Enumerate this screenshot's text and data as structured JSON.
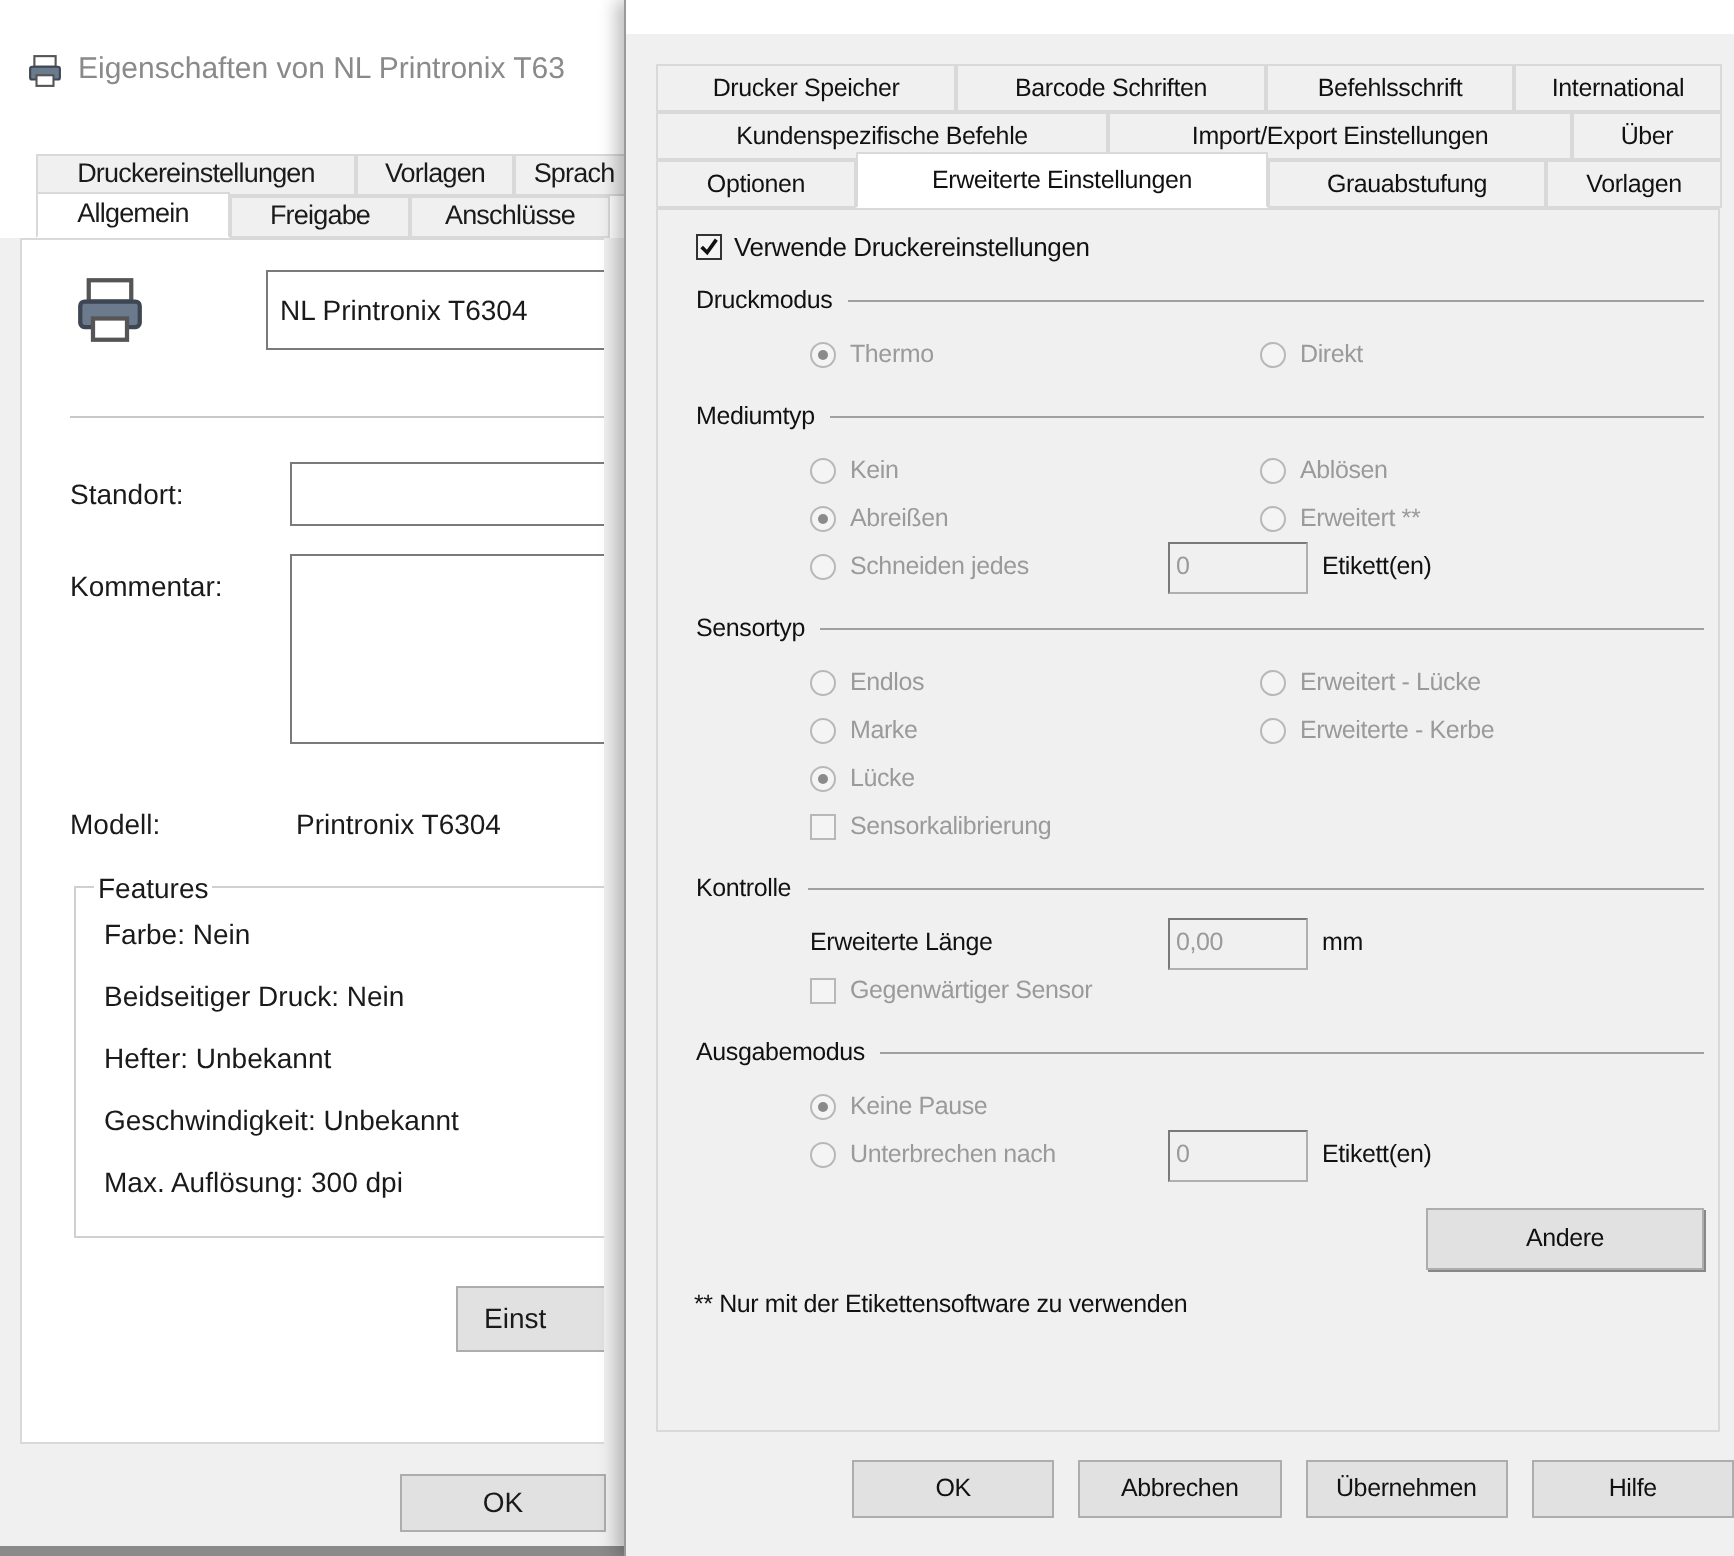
{
  "back_window": {
    "title": "Eigenschaften von NL Printronix T63",
    "tab_rows": [
      [
        {
          "label": "Druckereinstellungen",
          "selected": false
        },
        {
          "label": "Vorlagen",
          "selected": false
        },
        {
          "label": "Sprach",
          "selected": false
        }
      ],
      [
        {
          "label": "Allgemein",
          "selected": true
        },
        {
          "label": "Freigabe",
          "selected": false
        },
        {
          "label": "Anschlüsse",
          "selected": false
        }
      ]
    ],
    "printer_name": "NL Printronix T6304",
    "location_label": "Standort:",
    "comment_label": "Kommentar:",
    "model_label": "Modell:",
    "model_value": "Printronix T6304",
    "features": {
      "title": "Features",
      "items": [
        "Farbe: Nein",
        "Beidseitiger Druck: Nein",
        "Hefter: Unbekannt",
        "Geschwindigkeit: Unbekannt",
        "Max. Auflösung: 300 dpi"
      ]
    },
    "settings_button": "Einst",
    "ok_button": "OK"
  },
  "front_window": {
    "tab_rows": [
      [
        {
          "label": "Drucker Speicher",
          "selected": false
        },
        {
          "label": "Barcode Schriften",
          "selected": false
        },
        {
          "label": "Befehlsschrift",
          "selected": false
        },
        {
          "label": "International",
          "selected": false
        }
      ],
      [
        {
          "label": "Kundenspezifische Befehle",
          "selected": false
        },
        {
          "label": "Import/Export Einstellungen",
          "selected": false
        },
        {
          "label": "Über",
          "selected": false
        }
      ],
      [
        {
          "label": "Optionen",
          "selected": false
        },
        {
          "label": "Erweiterte Einstellungen",
          "selected": true
        },
        {
          "label": "Grauabstufung",
          "selected": false
        },
        {
          "label": "Vorlagen",
          "selected": false
        }
      ]
    ],
    "use_settings": {
      "label": "Verwende Druckereinstellungen",
      "checked": true
    },
    "sections": [
      {
        "title": "Druckmodus",
        "rows": [
          [
            {
              "kind": "radio",
              "label": "Thermo",
              "selected": true,
              "disabled": true
            },
            {
              "kind": "radio",
              "label": "Direkt",
              "selected": false,
              "disabled": true
            }
          ]
        ]
      },
      {
        "title": "Mediumtyp",
        "rows": [
          [
            {
              "kind": "radio",
              "label": "Kein",
              "selected": false,
              "disabled": true
            },
            {
              "kind": "radio",
              "label": "Ablösen",
              "selected": false,
              "disabled": true
            }
          ],
          [
            {
              "kind": "radio",
              "label": "Abreißen",
              "selected": true,
              "disabled": true
            },
            {
              "kind": "radio",
              "label": "Erweitert **",
              "selected": false,
              "disabled": true
            }
          ],
          [
            {
              "kind": "radio",
              "label": "Schneiden jedes",
              "selected": false,
              "disabled": true
            },
            {
              "kind": "field",
              "value": "0",
              "unit": "Etikett(en)"
            }
          ]
        ]
      },
      {
        "title": "Sensortyp",
        "rows": [
          [
            {
              "kind": "radio",
              "label": "Endlos",
              "selected": false,
              "disabled": true
            },
            {
              "kind": "radio",
              "label": "Erweitert - Lücke",
              "selected": false,
              "disabled": true
            }
          ],
          [
            {
              "kind": "radio",
              "label": "Marke",
              "selected": false,
              "disabled": true
            },
            {
              "kind": "radio",
              "label": "Erweiterte - Kerbe",
              "selected": false,
              "disabled": true
            }
          ],
          [
            {
              "kind": "radio",
              "label": "Lücke",
              "selected": true,
              "disabled": true
            }
          ],
          [
            {
              "kind": "checkbox",
              "label": "Sensorkalibrierung",
              "checked": false,
              "disabled": true
            }
          ]
        ]
      },
      {
        "title": "Kontrolle",
        "rows": [
          [
            {
              "kind": "label",
              "label": "Erweiterte Länge"
            },
            {
              "kind": "field",
              "value": "0,00",
              "unit": "mm"
            }
          ],
          [
            {
              "kind": "checkbox",
              "label": "Gegenwärtiger Sensor",
              "checked": false,
              "disabled": true
            }
          ]
        ]
      },
      {
        "title": "Ausgabemodus",
        "rows": [
          [
            {
              "kind": "radio",
              "label": "Keine Pause",
              "selected": true,
              "disabled": true
            }
          ],
          [
            {
              "kind": "radio",
              "label": "Unterbrechen nach",
              "selected": false,
              "disabled": true
            },
            {
              "kind": "field",
              "value": "0",
              "unit": "Etikett(en)"
            }
          ]
        ]
      }
    ],
    "other_button": "Andere",
    "footnote": "** Nur mit der Etikettensoftware zu verwenden",
    "buttons": [
      "OK",
      "Abbrechen",
      "Übernehmen",
      "Hilfe"
    ]
  }
}
